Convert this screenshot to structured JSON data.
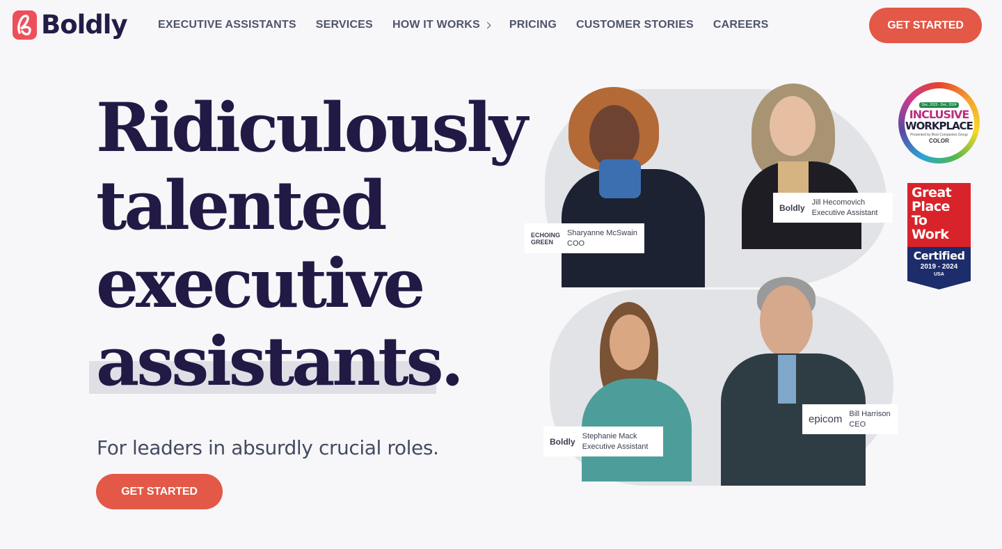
{
  "header": {
    "logo_text": "Boldly",
    "logo_icon": "boldly-b-icon",
    "nav": [
      {
        "label": "EXECUTIVE ASSISTANTS"
      },
      {
        "label": "SERVICES"
      },
      {
        "label": "HOW IT WORKS"
      },
      {
        "label": "PRICING"
      },
      {
        "label": "CUSTOMER STORIES"
      },
      {
        "label": "CAREERS"
      }
    ],
    "cta_label": "GET STARTED"
  },
  "hero": {
    "headline_lines": [
      "Ridiculously",
      "talented",
      "executive",
      "assistants."
    ],
    "subheadline": "For leaders in absurdly crucial roles.",
    "cta_label": "GET STARTED"
  },
  "people": [
    {
      "name": "Sharyanne McSwain",
      "role": "COO",
      "company": "ECHOING GREEN"
    },
    {
      "name": "Jill Hecomovich",
      "role": "Executive Assistant",
      "company": "Boldly"
    },
    {
      "name": "Stephanie Mack",
      "role": "Executive Assistant",
      "company": "Boldly"
    },
    {
      "name": "Bill Harrison",
      "role": "CEO",
      "company": "epicom"
    }
  ],
  "badges": {
    "inclusive": {
      "dates": "Dec. 2023 - Dec. 2024",
      "line1": "INCLUSIVE",
      "line2": "WORKPLACE",
      "presented": "Presented by Best Companies Group",
      "brand": "COLOR"
    },
    "gptw": {
      "title": "Great Place To Work",
      "certified": "Certified",
      "years": "2019 - 2024",
      "country": "USA"
    }
  },
  "colors": {
    "accent": "#e35846",
    "headline": "#221a45",
    "nav": "#4f536a",
    "background": "#f7f7f9"
  }
}
